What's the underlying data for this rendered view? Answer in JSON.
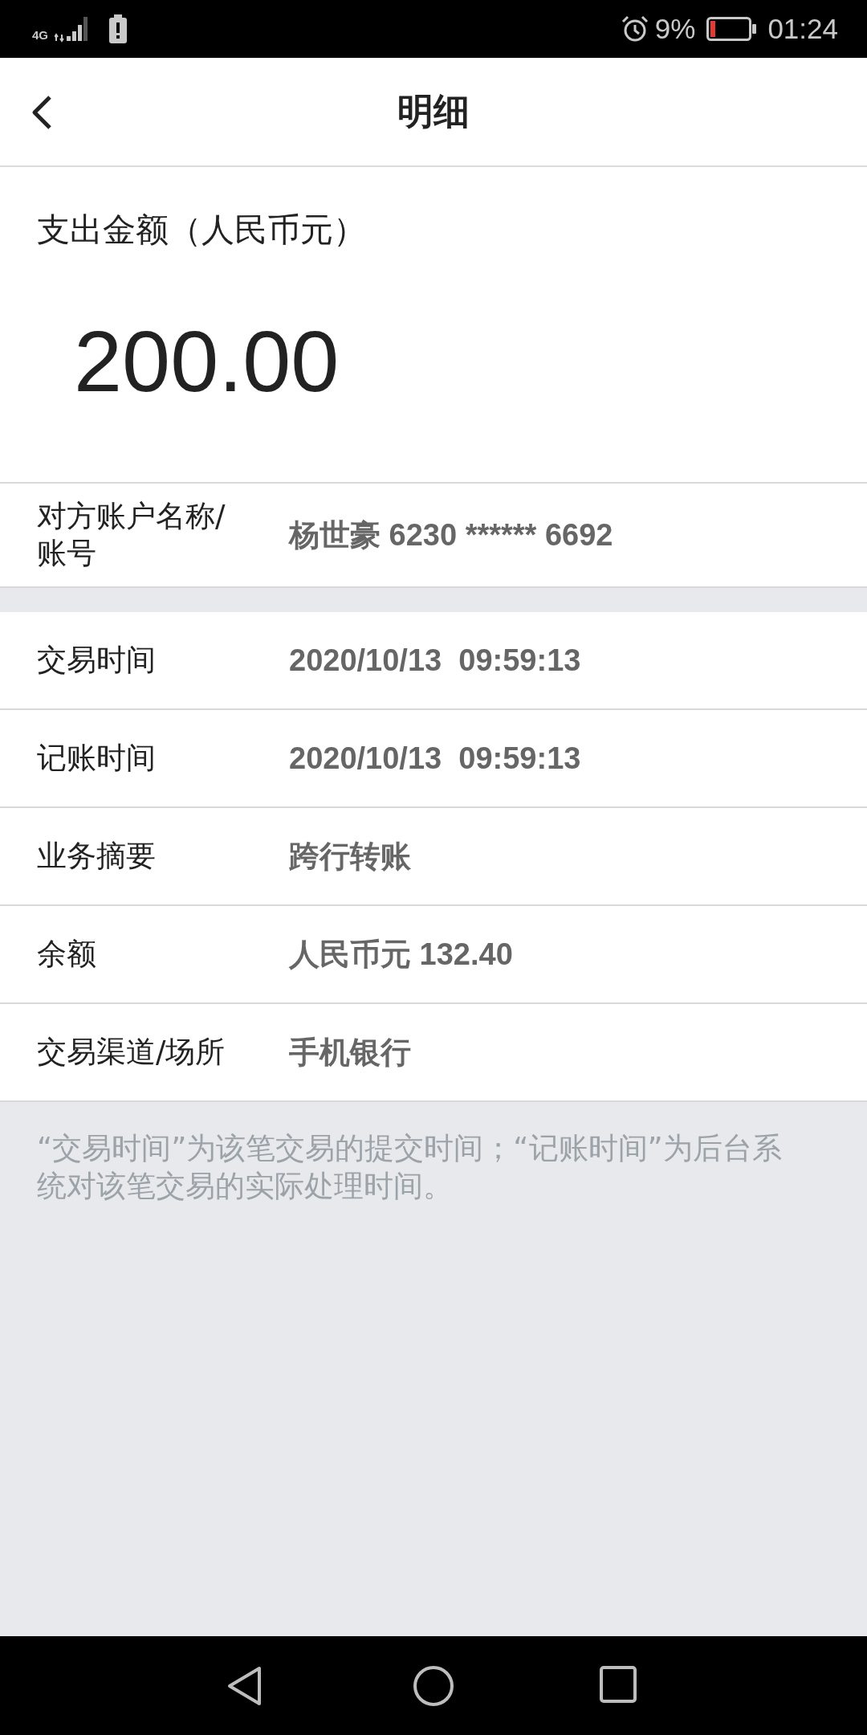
{
  "status_bar": {
    "network": "4G",
    "battery": "9%",
    "time": "01:24"
  },
  "header": {
    "title": "明细"
  },
  "amount": {
    "label": "支出金额（人民币元）",
    "value": "200.00"
  },
  "sections": [
    {
      "rows": [
        {
          "label": "对方账户名称/账号",
          "value": "杨世豪 6230 ****** 6692"
        }
      ]
    },
    {
      "rows": [
        {
          "label": "交易时间",
          "value": "2020/10/13  09:59:13"
        },
        {
          "label": "记账时间",
          "value": "2020/10/13  09:59:13"
        },
        {
          "label": "业务摘要",
          "value": "跨行转账"
        },
        {
          "label": "余额",
          "value": "人民币元 132.40"
        },
        {
          "label": "交易渠道/场所",
          "value": "手机银行"
        }
      ]
    }
  ],
  "note": "“交易时间”为该笔交易的提交时间；“记账时间”为后台系统对该笔交易的实际处理时间。"
}
